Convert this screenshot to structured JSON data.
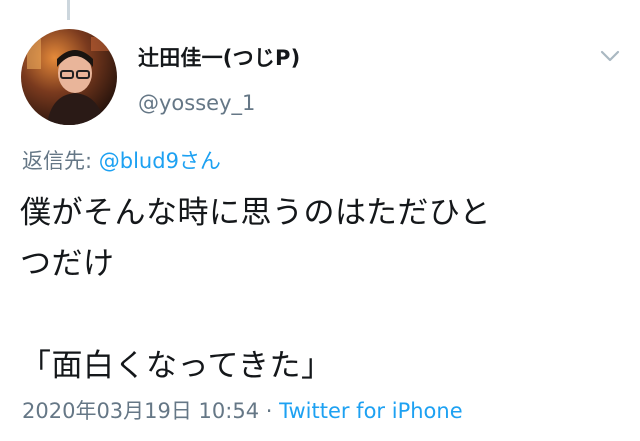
{
  "user": {
    "display_name": "辻田佳一(つじP)",
    "handle": "@yossey_1"
  },
  "reply": {
    "prefix": "返信先: ",
    "mention": "@blud9さん"
  },
  "tweet": {
    "text": "僕がそんな時に思うのはただひと\nつだけ\n\n「面白くなってきた」"
  },
  "meta": {
    "timestamp": "2020年03月19日 10:54",
    "separator": " · ",
    "source": "Twitter for iPhone"
  },
  "colors": {
    "text": "#14171a",
    "secondary": "#657786",
    "link": "#1da1f2"
  },
  "icons": {
    "more": "chevron-down-icon"
  }
}
